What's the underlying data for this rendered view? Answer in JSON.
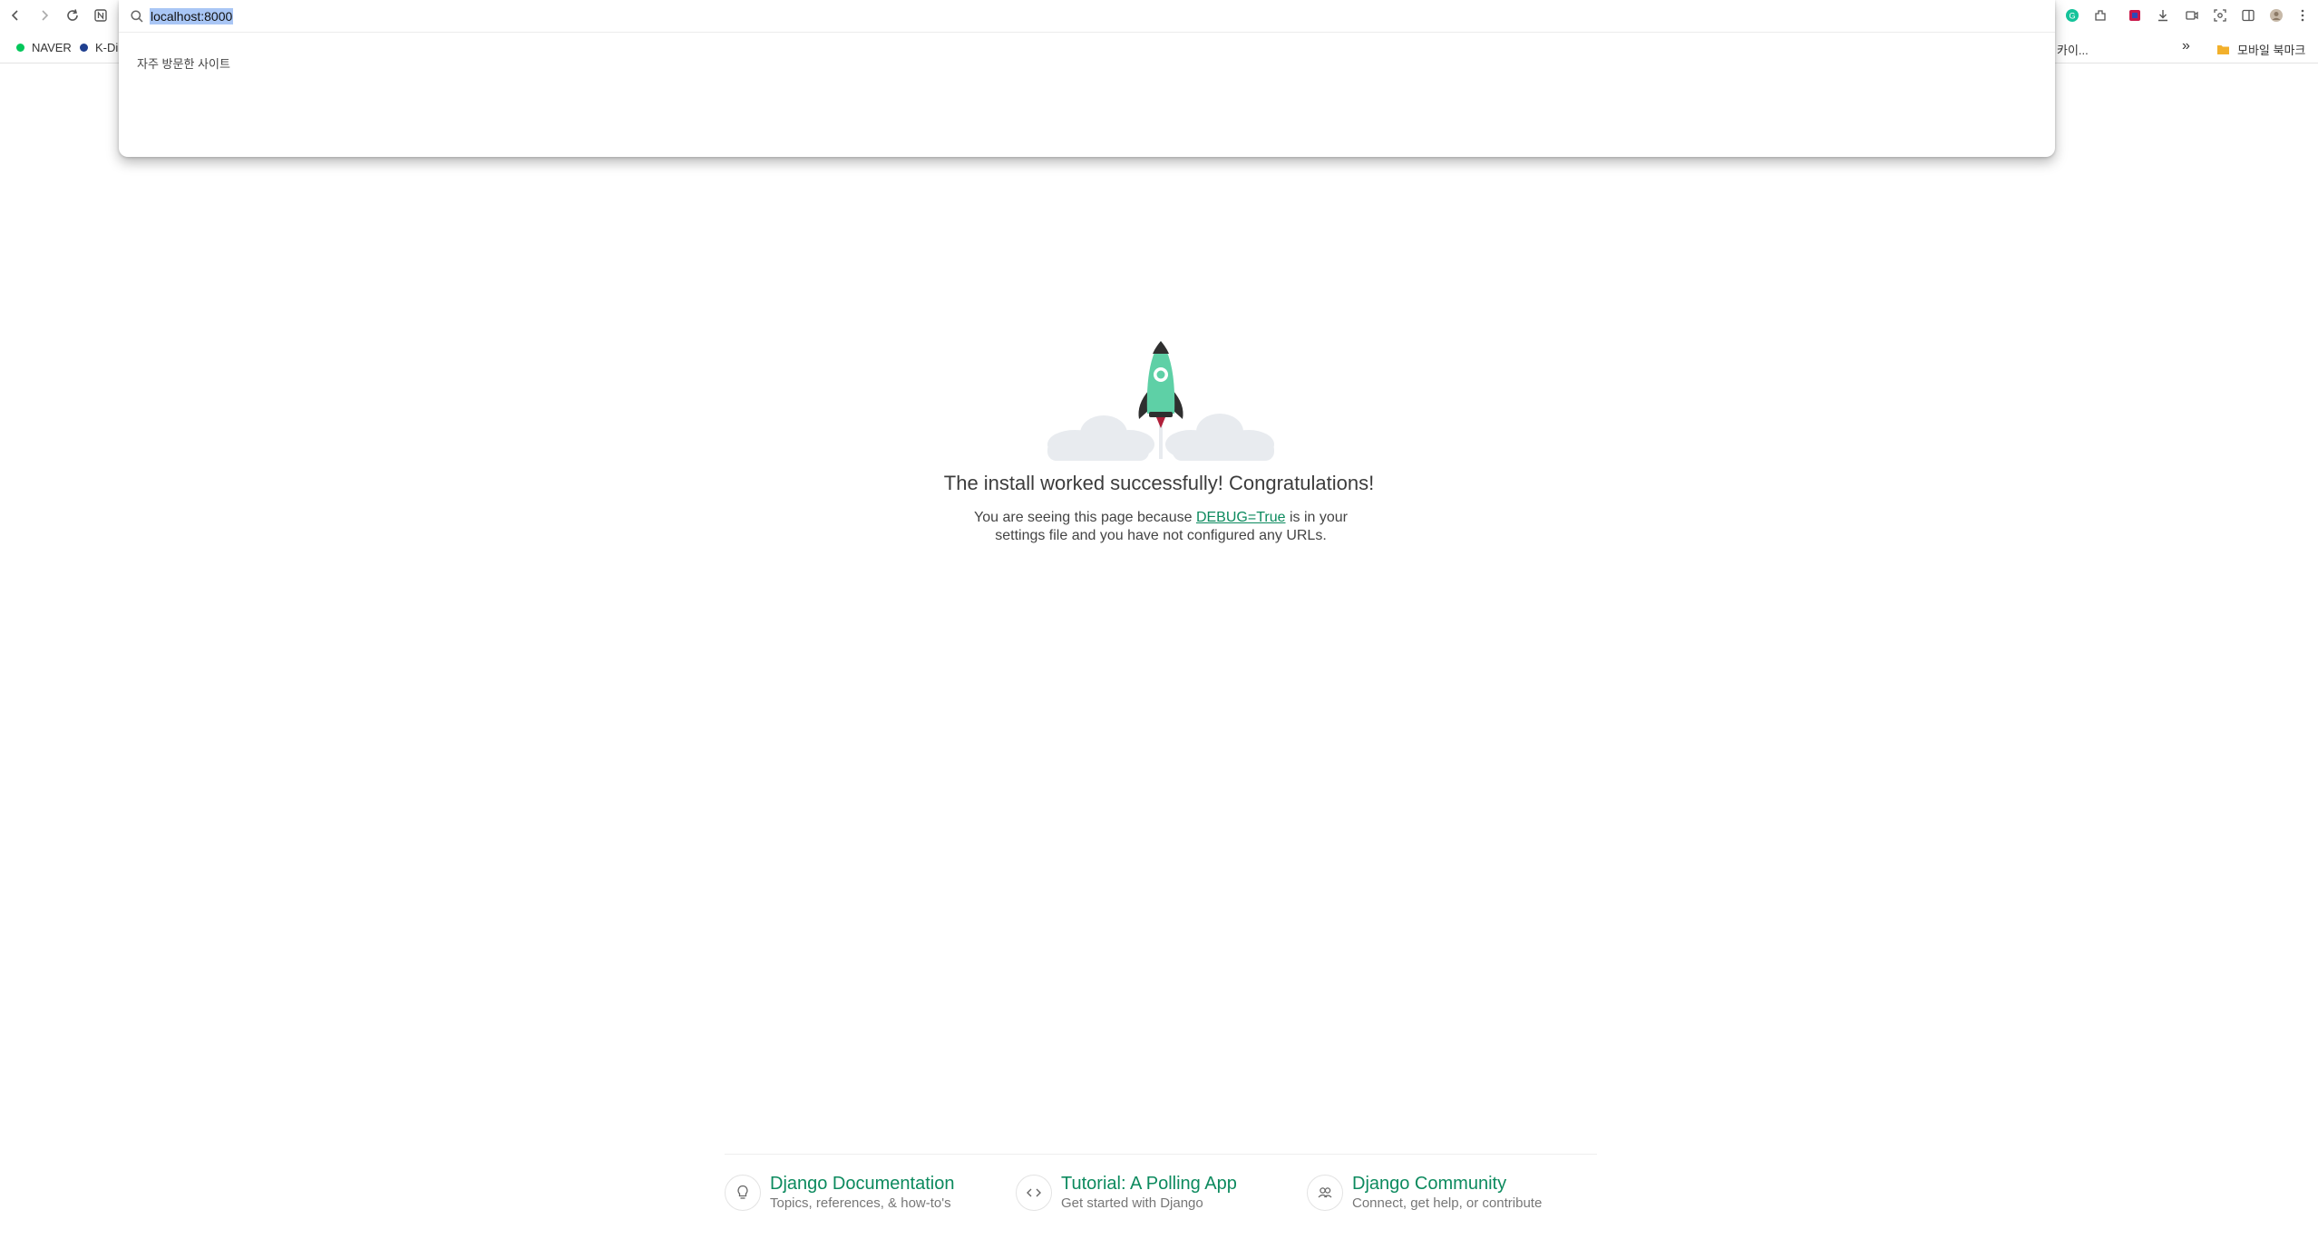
{
  "browser": {
    "address_value": "localhost:8000",
    "bookmarks": [
      {
        "label": "NAVER",
        "color": "#03c75a"
      },
      {
        "label": "K-Di",
        "color": "#1f3f8f"
      }
    ],
    "bookmarks_right_truncated": "카이...",
    "overflow_label": "»",
    "mobile_bookmarks_label": "모바일 북마크",
    "omnibox_section_label": "자주 방문한 사이트"
  },
  "page": {
    "headline": "The install worked successfully! Congratulations!",
    "sub_before": "You are seeing this page because ",
    "sub_link": "DEBUG=True",
    "sub_after": " is in your settings file and you have not configured any URLs.",
    "accent_color": "#0c8a5e"
  },
  "footer": {
    "cards": [
      {
        "title": "Django Documentation",
        "desc": "Topics, references, & how-to's",
        "icon": "lightbulb-icon"
      },
      {
        "title": "Tutorial: A Polling App",
        "desc": "Get started with Django",
        "icon": "code-icon"
      },
      {
        "title": "Django Community",
        "desc": "Connect, get help, or contribute",
        "icon": "people-icon"
      }
    ]
  }
}
